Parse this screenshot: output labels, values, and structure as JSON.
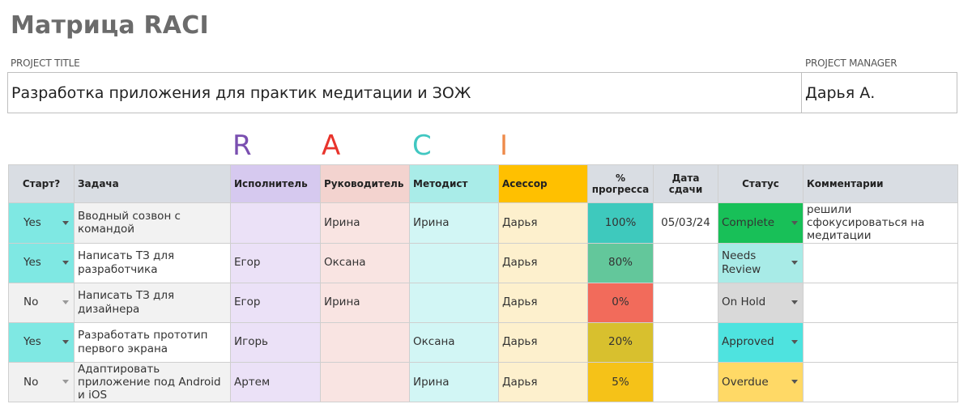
{
  "page": {
    "title": "Матрица RACI",
    "project_title_label": "PROJECT TITLE",
    "project_manager_label": "PROJECT MANAGER",
    "project_title": "Разработка приложения для практик медитации и ЗОЖ",
    "project_manager": "Дарья А."
  },
  "raci": {
    "r": {
      "letter": "R",
      "color": "#7a4fb0"
    },
    "a": {
      "letter": "A",
      "color": "#e8342c"
    },
    "c": {
      "letter": "C",
      "color": "#41c7c1"
    },
    "i": {
      "letter": "I",
      "color": "#ee8a4a"
    }
  },
  "table": {
    "headers": {
      "start": "Старт?",
      "task": "Задача",
      "responsible": "Исполнитель",
      "accountable": "Руководитель",
      "consulted": "Методист",
      "informed": "Асессор",
      "progress": "% прогресса",
      "due": "Дата сдачи",
      "status": "Статус",
      "comments": "Комментарии"
    },
    "rows": [
      {
        "start": "Yes",
        "task": "Вводный созвон с командой",
        "responsible": "",
        "accountable": "Ирина",
        "consulted": "Ирина",
        "informed": "Дарья",
        "progress": "100%",
        "progress_color": "#3ec9bd",
        "due": "05/03/24",
        "status": "Complete",
        "status_color": "#18c058",
        "comment": "решили сфокусироваться на медитации"
      },
      {
        "start": "Yes",
        "task": "Написать ТЗ для разработчика",
        "responsible": "Егор",
        "accountable": "Оксана",
        "consulted": "",
        "informed": "Дарья",
        "progress": "80%",
        "progress_color": "#63c79b",
        "due": "",
        "status": "Needs Review",
        "status_color": "#a8ebe7",
        "comment": ""
      },
      {
        "start": "No",
        "task": "Написать ТЗ для дизайнера",
        "responsible": "Егор",
        "accountable": "Ирина",
        "consulted": "",
        "informed": "Дарья",
        "progress": "0%",
        "progress_color": "#f26b5b",
        "due": "",
        "status": "On Hold",
        "status_color": "#d9d9d9",
        "comment": ""
      },
      {
        "start": "Yes",
        "task": "Разработать прототип первого экрана",
        "responsible": "Игорь",
        "accountable": "",
        "consulted": "Оксана",
        "informed": "Дарья",
        "progress": "20%",
        "progress_color": "#d8c02e",
        "due": "",
        "status": "Approved",
        "status_color": "#4ee3df",
        "comment": ""
      },
      {
        "start": "No",
        "task": "Адаптировать приложение под Android и iOS",
        "responsible": "Артем",
        "accountable": "",
        "consulted": "Ирина",
        "informed": "Дарья",
        "progress": "5%",
        "progress_color": "#f5c218",
        "due": "",
        "status": "Overdue",
        "status_color": "#ffd966",
        "comment": ""
      }
    ]
  },
  "colors": {
    "start_yes": "#7fe8e3",
    "start_no": "#f1f1f1",
    "task_bg": "#f2f2f2",
    "responsible_bg": "#ebe1f7",
    "accountable_bg": "#f9e4e2",
    "consulted_bg": "#d2f6f5",
    "informed_bg": "#fdf0cd",
    "header_bg": "#d9dde3",
    "header_responsible": "#d6c9ef",
    "header_accountable": "#f3d3cf",
    "header_consulted": "#a9ece8",
    "header_informed": "#ffc000"
  }
}
